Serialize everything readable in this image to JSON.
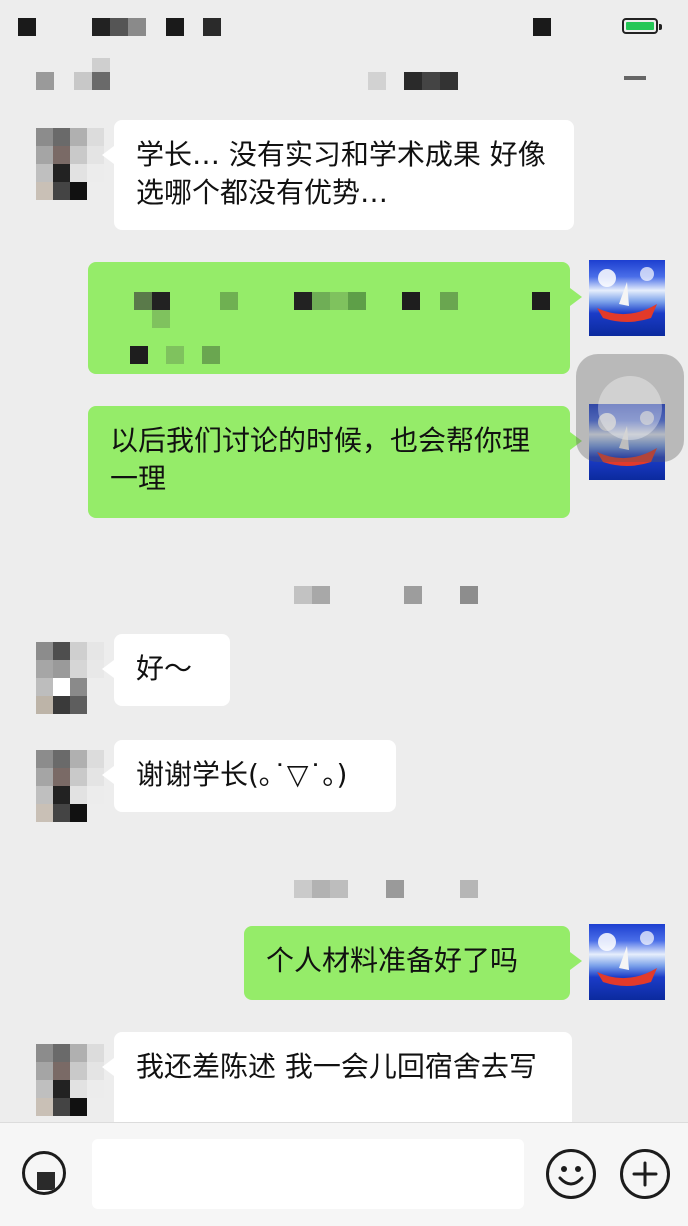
{
  "messages": [
    {
      "side": "in",
      "text": "学长… 没有实习和学术成果 好像选哪个都没有优势…"
    },
    {
      "side": "out",
      "text": ""
    },
    {
      "side": "out",
      "text": "以后我们讨论的时候，也会帮你理一理"
    },
    {
      "side": "in",
      "text": "好～"
    },
    {
      "side": "in",
      "text": "谢谢学长(｡˙▽˙｡)"
    },
    {
      "side": "out",
      "text": "个人材料准备好了吗"
    },
    {
      "side": "in",
      "text": "我还差陈述 我一会儿回宿舍去写"
    }
  ],
  "input": {
    "value": "",
    "placeholder": ""
  },
  "colors": {
    "background": "#ededed",
    "incoming_bubble": "#ffffff",
    "outgoing_bubble": "#95ec69",
    "battery": "#24c756"
  },
  "icons": {
    "emoji": "smiley-icon",
    "more": "plus-icon",
    "battery": "battery-icon"
  }
}
